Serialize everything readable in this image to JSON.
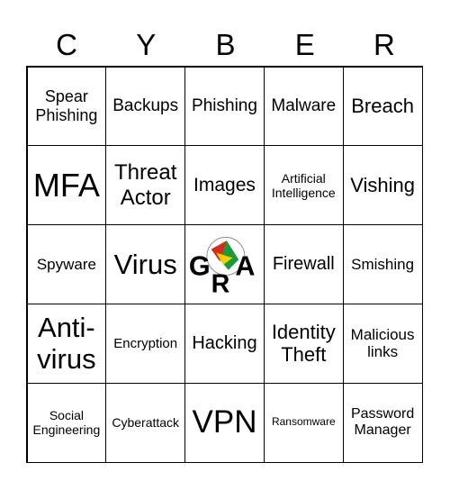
{
  "header": [
    "C",
    "Y",
    "B",
    "E",
    "R"
  ],
  "cells": [
    {
      "text": "Spear Phishing",
      "size": 18
    },
    {
      "text": "Backups",
      "size": 19
    },
    {
      "text": "Phishing",
      "size": 19
    },
    {
      "text": "Malware",
      "size": 19
    },
    {
      "text": "Breach",
      "size": 22
    },
    {
      "text": "MFA",
      "size": 36
    },
    {
      "text": "Threat Actor",
      "size": 24
    },
    {
      "text": "Images",
      "size": 21
    },
    {
      "text": "Artificial Intelligence",
      "size": 14
    },
    {
      "text": "Vishing",
      "size": 22
    },
    {
      "text": "Spyware",
      "size": 17
    },
    {
      "text": "Virus",
      "size": 31
    },
    {
      "text": "",
      "logo": "GRA",
      "size": 0
    },
    {
      "text": "Firewall",
      "size": 20
    },
    {
      "text": "Smishing",
      "size": 17
    },
    {
      "text": "Anti-virus",
      "size": 31
    },
    {
      "text": "Encryption",
      "size": 15
    },
    {
      "text": "Hacking",
      "size": 20
    },
    {
      "text": "Identity Theft",
      "size": 22
    },
    {
      "text": "Malicious links",
      "size": 17
    },
    {
      "text": "Social Engineering",
      "size": 14
    },
    {
      "text": "Cyberattack",
      "size": 14
    },
    {
      "text": "VPN",
      "size": 35
    },
    {
      "text": "Ransomware",
      "size": 12
    },
    {
      "text": "Password Manager",
      "size": 16
    }
  ]
}
